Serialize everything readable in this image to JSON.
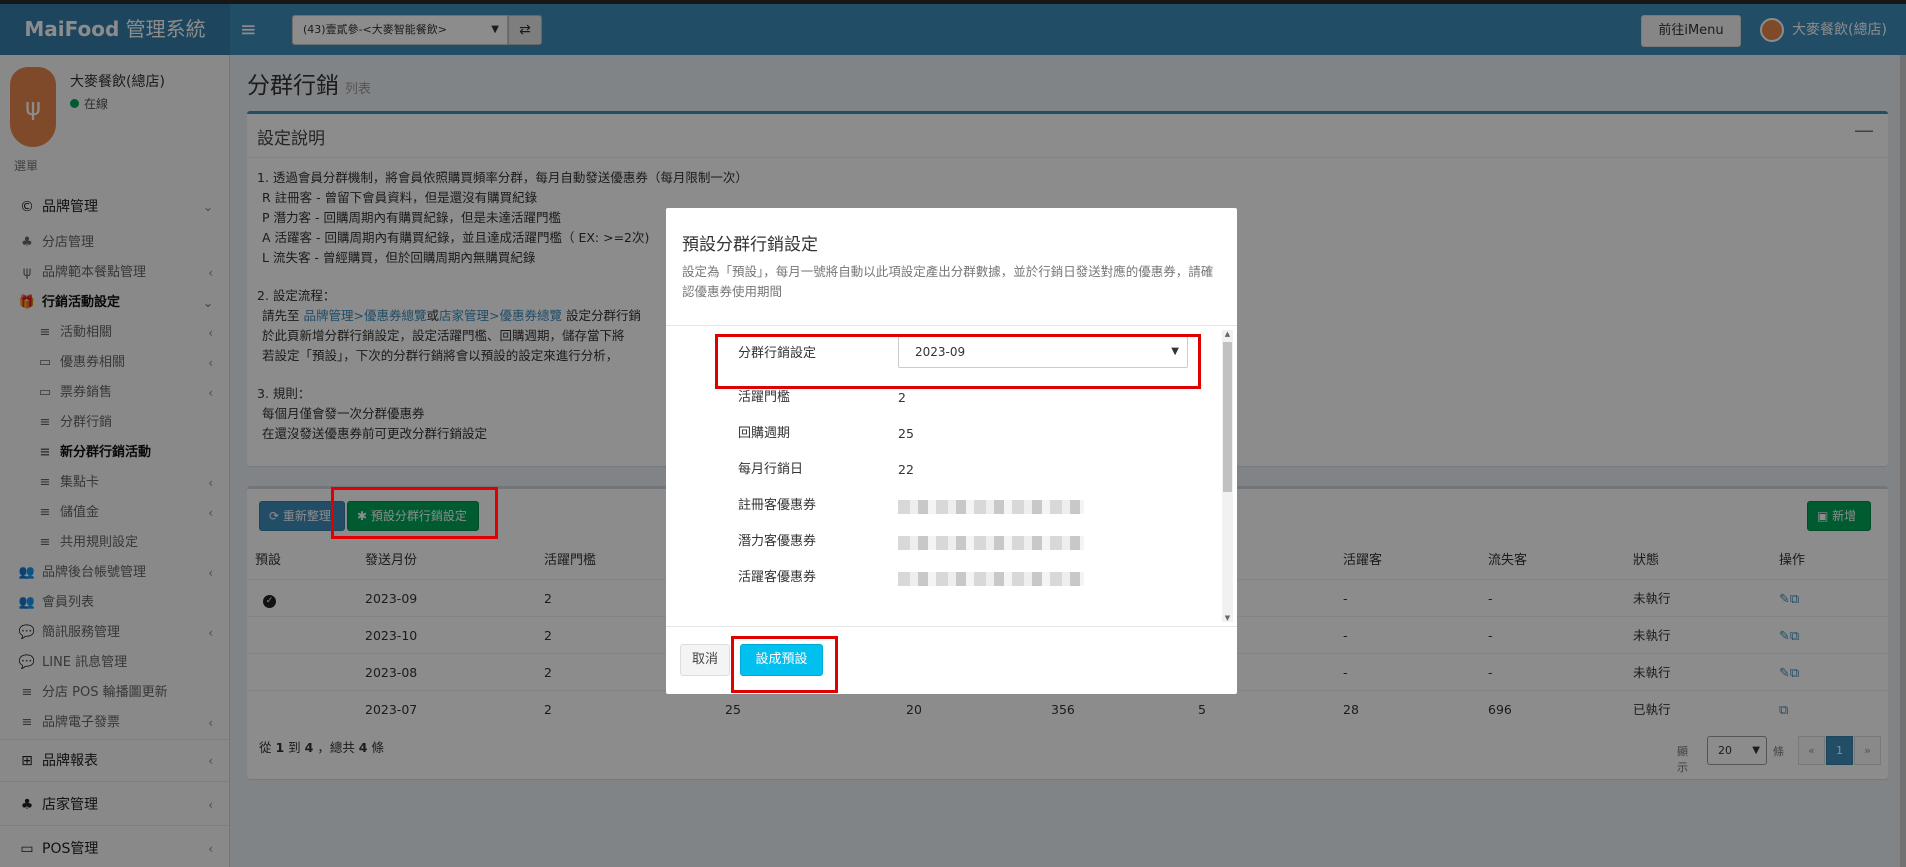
{
  "header": {
    "logo_bold": "MaiFood",
    "logo_light": " 管理系統",
    "brand_select": "(43)壹貳參-<大麥智能餐飲>",
    "imenu_button": "前往iMenu",
    "user_name": "大麥餐飲(總店)"
  },
  "sidebar": {
    "user_name": "大麥餐飲(總店)",
    "status": "在線",
    "menu_header": "選單",
    "items": [
      {
        "label": "品牌管理",
        "icon": "copyright-icon"
      },
      {
        "label": "分店管理",
        "icon": "sitemap-icon"
      },
      {
        "label": "品牌範本餐點管理",
        "icon": "cutlery-icon"
      },
      {
        "label": "行銷活動設定",
        "icon": "gift-icon"
      },
      {
        "label": "活動相關",
        "icon": "list-icon"
      },
      {
        "label": "優惠券相關",
        "icon": "ticket-icon"
      },
      {
        "label": "票券銷售",
        "icon": "ticket-icon"
      },
      {
        "label": "分群行銷",
        "icon": "list-icon"
      },
      {
        "label": "新分群行銷活動",
        "icon": "list-icon"
      },
      {
        "label": "集點卡",
        "icon": "list-icon"
      },
      {
        "label": "儲值金",
        "icon": "list-icon"
      },
      {
        "label": "共用規則設定",
        "icon": "list-icon"
      },
      {
        "label": "品牌後台帳號管理",
        "icon": "users-icon"
      },
      {
        "label": "會員列表",
        "icon": "users-icon"
      },
      {
        "label": "簡訊服務管理",
        "icon": "comments-icon"
      },
      {
        "label": "LINE 訊息管理",
        "icon": "comment-icon"
      },
      {
        "label": "分店 POS 輪播圖更新",
        "icon": "list-icon"
      },
      {
        "label": "品牌電子發票",
        "icon": "list-icon"
      },
      {
        "label": "品牌報表",
        "icon": "table-icon"
      },
      {
        "label": "店家管理",
        "icon": "sitemap-icon"
      },
      {
        "label": "POS管理",
        "icon": "desktop-icon"
      }
    ]
  },
  "page": {
    "title": "分群行銷",
    "subtitle": "列表"
  },
  "settings": {
    "title": "設定說明",
    "minimize": "—",
    "line1": "1. 透過會員分群機制，將會員依照購買頻率分群，每月自動發送優惠券（每月限制一次）",
    "line2": "R 註冊客 - 曾留下會員資料，但是還沒有購買紀錄",
    "line3": "P 潛力客 - 回購周期內有購買紀錄，但是未達活躍門檻",
    "line4": "A 活躍客 - 回購周期內有購買紀錄，並且達成活躍門檻（ EX: >=2次)",
    "line5": "L 流失客 - 曾經購買，但於回購周期內無購買紀錄",
    "line6": "2. 設定流程：",
    "line7_pre": "請先至 ",
    "link1": "品牌管理",
    "sep1": ">",
    "link2": "優惠券總覽",
    "or": "或",
    "link3": "店家管理",
    "sep2": ">",
    "link4": "優惠券總覽",
    "line7_post": " 設定分群行銷",
    "line8": "於此頁新增分群行銷設定，設定活躍門檻、回購週期，儲存當下將",
    "line9": "若設定「預設」，下次的分群行銷將會以預設的設定來進行分析，",
    "line10": "3. 規則：",
    "line11": "每個月僅會發一次分群優惠券",
    "line12": "在還沒發送優惠券前可更改分群行銷設定"
  },
  "toolbar": {
    "refresh": "重新整理",
    "preset": "預設分群行銷設定",
    "add": "新增"
  },
  "table": {
    "headers": [
      "預設",
      "發送月份",
      "活躍門檻",
      "活躍客",
      "流失客",
      "狀態",
      "操作"
    ],
    "rows": [
      {
        "month": "2023-09",
        "threshold": "2",
        "col3": "",
        "col4": "",
        "col5": "",
        "col6": "",
        "active": "-",
        "lost": "-",
        "status": "未執行",
        "default": true
      },
      {
        "month": "2023-10",
        "threshold": "2",
        "col3": "",
        "col4": "",
        "col5": "",
        "col6": "",
        "active": "-",
        "lost": "-",
        "status": "未執行",
        "default": false
      },
      {
        "month": "2023-08",
        "threshold": "2",
        "col3": "",
        "col4": "",
        "col5": "",
        "col6": "",
        "active": "-",
        "lost": "-",
        "status": "未執行",
        "default": false
      },
      {
        "month": "2023-07",
        "threshold": "2",
        "col3": "25",
        "col4": "20",
        "col5": "356",
        "col6": "5",
        "active": "28",
        "lost": "696",
        "status": "已執行",
        "default": false
      }
    ]
  },
  "footer": {
    "info_pre": "從 ",
    "from": "1",
    "to_word": " 到 ",
    "to": "4",
    "total_word": " ，總共 ",
    "total": "4",
    "unit": " 條",
    "show": "顯示",
    "page_size": "20",
    "items": "條",
    "prev": "«",
    "page": "1",
    "next": "»"
  },
  "modal": {
    "title": "預設分群行銷設定",
    "desc": "設定為「預設」，每月一號將自動以此項設定產出分群數據，並於行銷日發送對應的優惠券，請確認優惠券使用期間",
    "select_label": "分群行銷設定",
    "select_value": "2023-09",
    "threshold_label": "活躍門檻",
    "threshold_value": "2",
    "cycle_label": "回購週期",
    "cycle_value": "25",
    "day_label": "每月行銷日",
    "day_value": "22",
    "reg_label": "註冊客優惠券",
    "pot_label": "潛力客優惠券",
    "act_label": "活躍客優惠券",
    "cancel": "取消",
    "save": "設成預設"
  },
  "colors": {
    "primary": "#3c8dbc",
    "success": "#00a65a",
    "info": "#00c0ef",
    "highlight": "#e00000"
  }
}
